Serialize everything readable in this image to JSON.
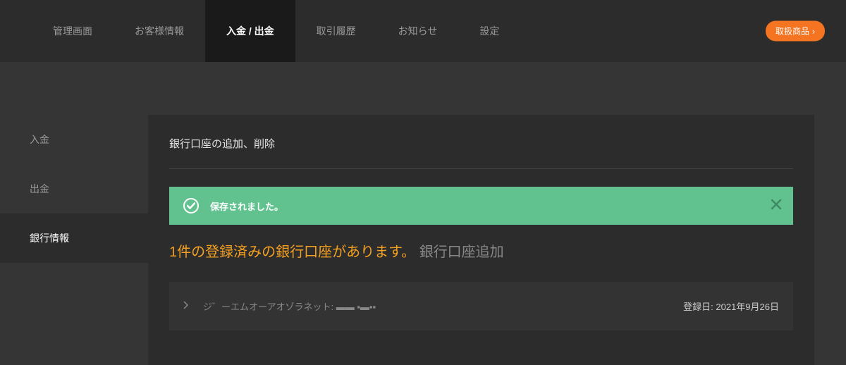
{
  "topNav": {
    "items": [
      {
        "label": "管理画面"
      },
      {
        "label": "お客様情報"
      },
      {
        "label": "入金 / 出金"
      },
      {
        "label": "取引履歴"
      },
      {
        "label": "お知らせ"
      },
      {
        "label": "設定"
      }
    ],
    "rightButton": "取扱商品"
  },
  "sidebar": {
    "items": [
      {
        "label": "入金"
      },
      {
        "label": "出金"
      },
      {
        "label": "銀行情報"
      }
    ]
  },
  "main": {
    "title": "銀行口座の追加、削除",
    "alert": {
      "text": "保存されました。"
    },
    "infoHighlight": "1件の登録済みの銀行口座があります。",
    "infoLink": "銀行口座追加",
    "account": {
      "name": "ジ゛ーエムオーアオゾラネット: ▬▬ ▪▬▪▪",
      "dateLabel": "登録日: ",
      "dateValue": "2021年9月26日"
    }
  }
}
